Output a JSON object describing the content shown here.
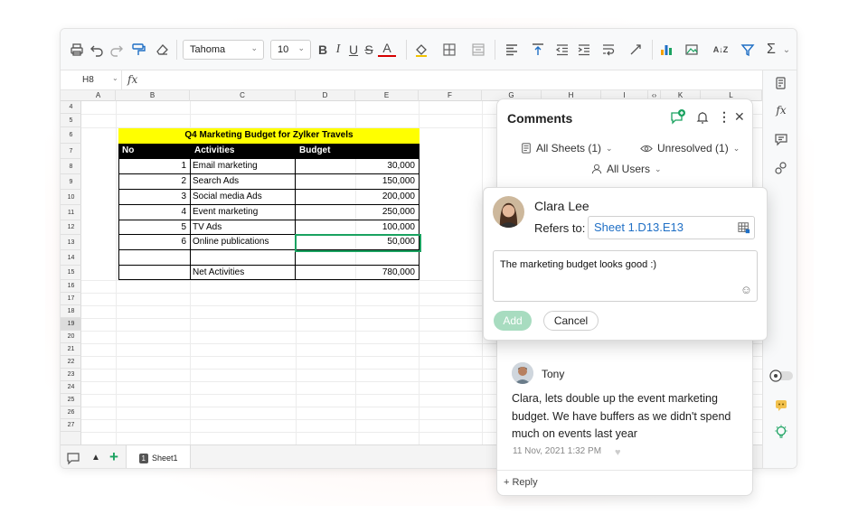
{
  "toolbar": {
    "font_name": "Tahoma",
    "font_size": "10",
    "bold": "B",
    "italic": "I",
    "underline": "U",
    "strike": "S",
    "font_color": "A",
    "sort": "A↓Z"
  },
  "formula_bar": {
    "cell_ref": "H8",
    "fx": "fx"
  },
  "columns": [
    "A",
    "B",
    "C",
    "D",
    "E",
    "F",
    "G",
    "H",
    "I",
    "‹›",
    "K",
    "L"
  ],
  "rows": [
    "4",
    "5",
    "6",
    "7",
    "8",
    "9",
    "10",
    "11",
    "12",
    "13",
    "14",
    "15",
    "16",
    "17",
    "18",
    "19",
    "20",
    "21",
    "22",
    "23",
    "24",
    "25",
    "26",
    "27"
  ],
  "table": {
    "title": "Q4 Marketing Budget for Zylker Travels",
    "headers": [
      "No",
      "Activities",
      "Budget"
    ],
    "rows": [
      {
        "no": "1",
        "activity": "Email marketing",
        "budget": "30,000"
      },
      {
        "no": "2",
        "activity": "Search Ads",
        "budget": "150,000"
      },
      {
        "no": "3",
        "activity": "Social media Ads",
        "budget": "200,000"
      },
      {
        "no": "4",
        "activity": "Event marketing",
        "budget": "250,000"
      },
      {
        "no": "5",
        "activity": "TV Ads",
        "budget": "100,000"
      },
      {
        "no": "6",
        "activity": "Online publications",
        "budget": "50,000"
      }
    ],
    "net_label": "Net Activities",
    "net_value": "780,000"
  },
  "sheet_tab": {
    "number": "1",
    "name": "Sheet1"
  },
  "comments_panel": {
    "title": "Comments",
    "filter_sheets": "All Sheets  (1)",
    "filter_status": "Unresolved  (1)",
    "filter_users": "All Users",
    "thread": {
      "author": "Tony",
      "text": "Clara, lets double up the event marketing budget. We have buffers as we didn't spend much on events last year",
      "timestamp": "11 Nov, 2021 1:32 PM",
      "reply": "+ Reply"
    }
  },
  "new_comment": {
    "author": "Clara Lee",
    "refers_label": "Refers to:",
    "refers_value": "Sheet 1.D13.E13",
    "text": "The marketing budget looks good :)",
    "add": "Add",
    "cancel": "Cancel"
  },
  "colors": {
    "accent_green": "#1aa260",
    "title_fill": "#ffff00",
    "link_blue": "#1f6fc5"
  }
}
